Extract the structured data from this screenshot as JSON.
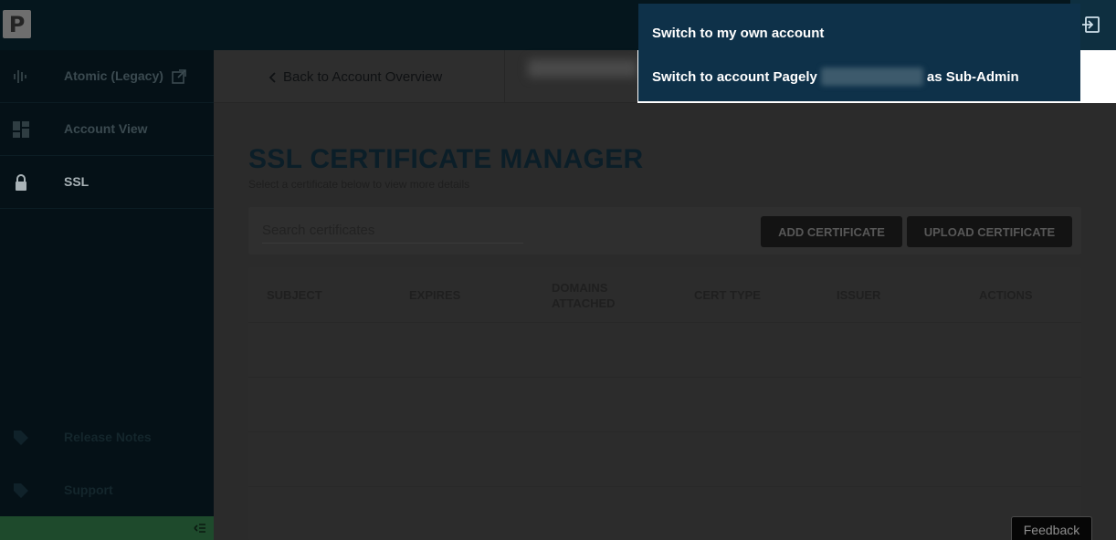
{
  "topbar": {
    "logo_text": "P"
  },
  "sidebar": {
    "items": [
      {
        "label": "Atomic (Legacy)",
        "icon": "soundwave-icon"
      },
      {
        "label": "Account View",
        "icon": "dashboard-icon"
      },
      {
        "label": "SSL",
        "icon": "lock-icon",
        "active": true
      },
      {
        "label": "Release Notes",
        "icon": "tag-icon"
      },
      {
        "label": "Support",
        "icon": "tag-icon"
      }
    ]
  },
  "subheader": {
    "back_label": "Back to Account Overview"
  },
  "page": {
    "title": "SSL CERTIFICATE MANAGER",
    "subtitle": "Select a certificate below to view more details"
  },
  "toolbar": {
    "search_placeholder": "Search certificates",
    "add_label": "ADD CERTIFICATE",
    "upload_label": "UPLOAD CERTIFICATE"
  },
  "table": {
    "columns": [
      "SUBJECT",
      "EXPIRES",
      "DOMAINS ATTACHED",
      "CERT TYPE",
      "ISSUER",
      "ACTIONS"
    ]
  },
  "popup": {
    "item_own": "Switch to my own account",
    "item_sub_prefix": "Switch to account Pagely",
    "item_sub_suffix": "as Sub-Admin"
  },
  "feedback_label": "Feedback",
  "colors": {
    "accent_green": "#1e4a2c",
    "popup_bg": "#0e3149",
    "sidebar_bg": "#051117"
  }
}
